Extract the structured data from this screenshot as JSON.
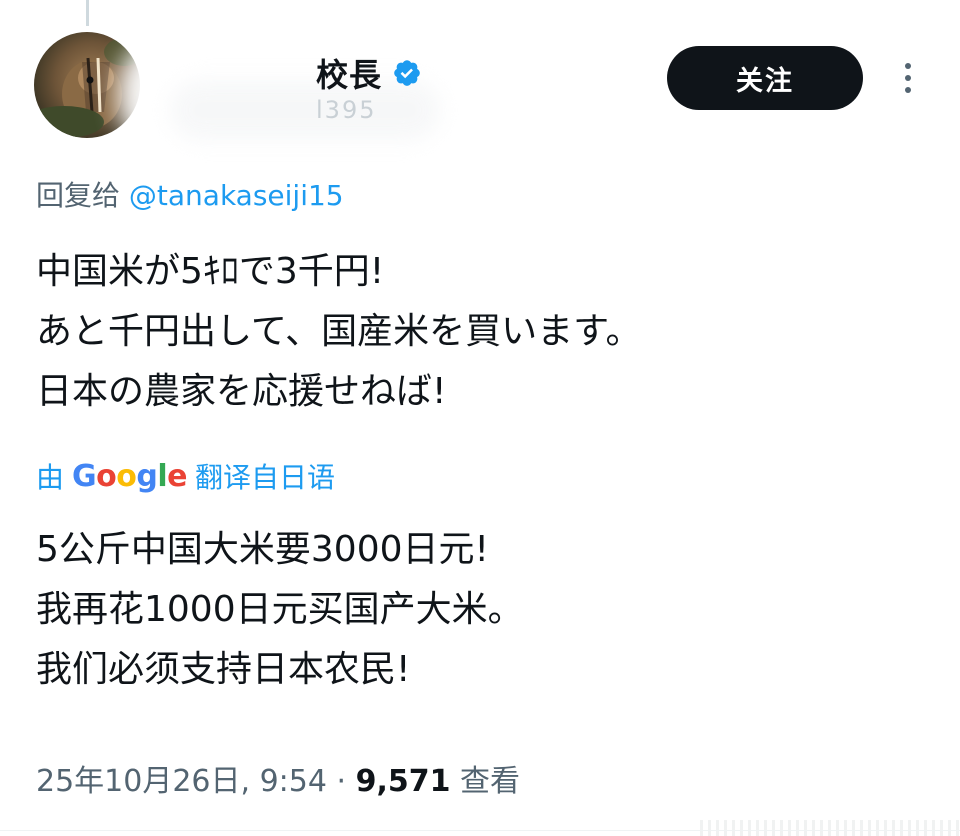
{
  "author": {
    "name_suffix": "校長",
    "handle_partial": "l395",
    "verified": true
  },
  "follow_label": "关注",
  "reply": {
    "prefix": "回复给 ",
    "mention": "@tanakaseiji15"
  },
  "tweet_lines": [
    "中国米が5ｷﾛで3千円!",
    "あと千円出して、国産米を買います。",
    "日本の農家を応援せねば!"
  ],
  "translation": {
    "by_label": "由",
    "brand": "Google",
    "suffix": "翻译自日语"
  },
  "translated_lines": [
    "5公斤中国大米要3000日元!",
    "我再花1000日元买国产大米。",
    "我们必须支持日本农民!"
  ],
  "meta": {
    "timestamp": "25年10月26日, 9:54",
    "separator": " · ",
    "views": "9,571",
    "views_label": " 查看"
  },
  "colors": {
    "accent": "#1d9bf0",
    "text": "#0f1419",
    "secondary": "#536471",
    "button": "#0f1419"
  }
}
